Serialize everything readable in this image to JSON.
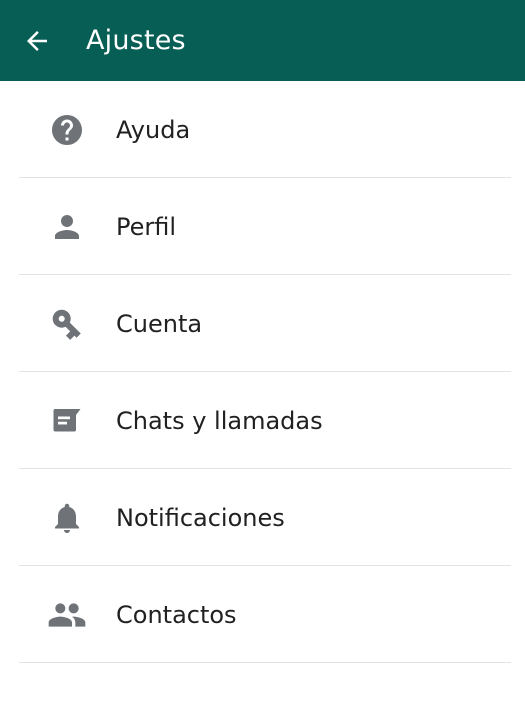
{
  "appbar": {
    "title": "Ajustes",
    "back_icon": "arrow-back-icon",
    "color": "#075e54"
  },
  "settings": {
    "items": [
      {
        "label": "Ayuda",
        "icon": "help-icon"
      },
      {
        "label": "Perfil",
        "icon": "person-icon"
      },
      {
        "label": "Cuenta",
        "icon": "key-icon"
      },
      {
        "label": "Chats y llamadas",
        "icon": "chat-icon"
      },
      {
        "label": "Notificaciones",
        "icon": "bell-icon"
      },
      {
        "label": "Contactos",
        "icon": "contacts-icon"
      }
    ]
  }
}
